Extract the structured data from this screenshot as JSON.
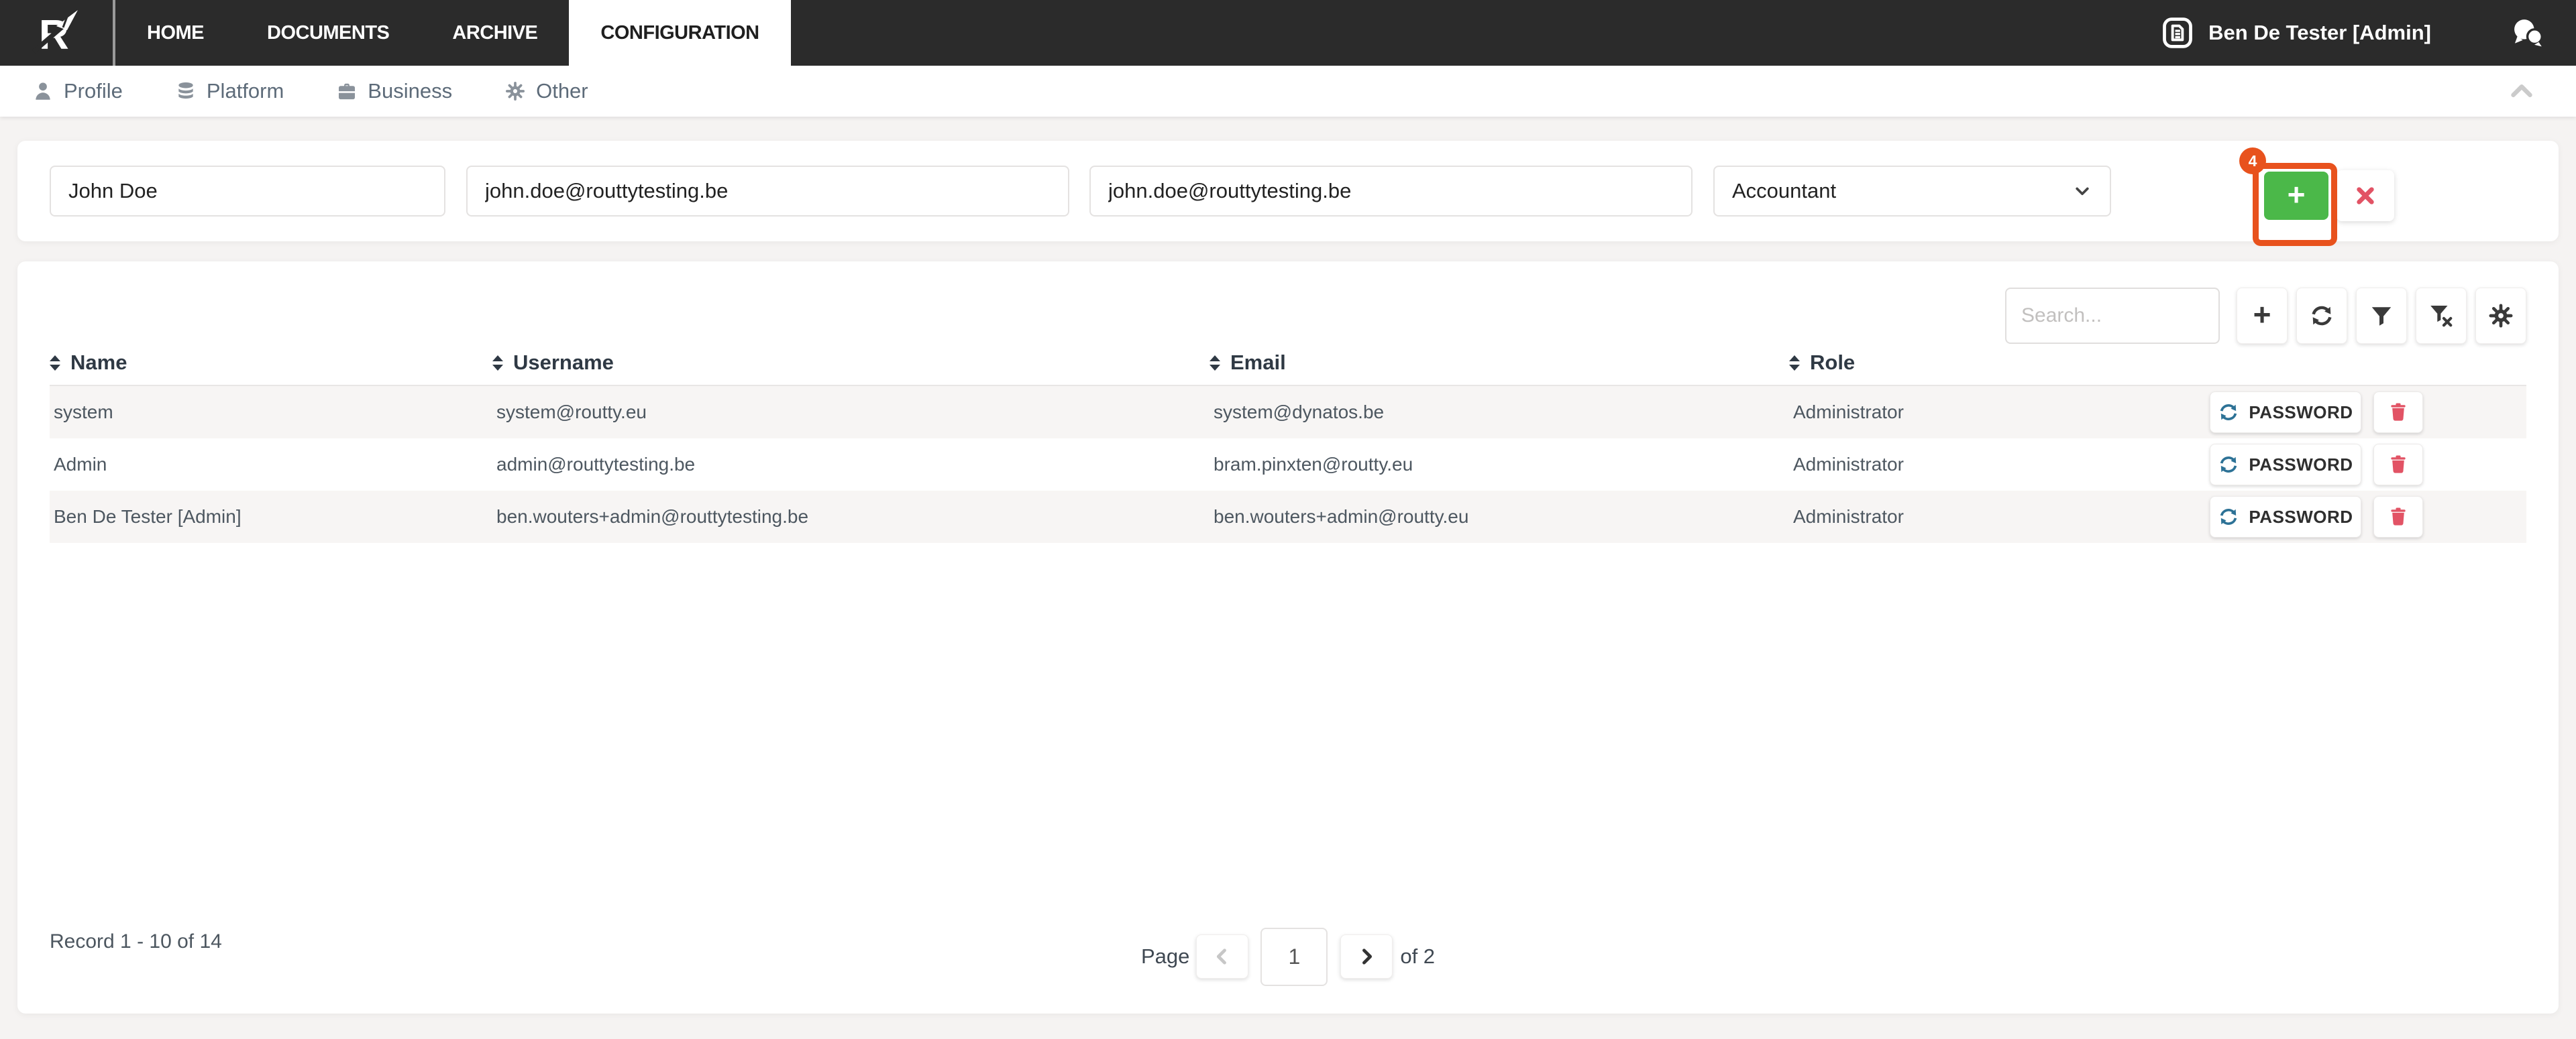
{
  "nav": {
    "items": [
      {
        "label": "HOME",
        "active": false
      },
      {
        "label": "DOCUMENTS",
        "active": false
      },
      {
        "label": "ARCHIVE",
        "active": false
      },
      {
        "label": "CONFIGURATION",
        "active": true
      }
    ],
    "user_label": "Ben De Tester [Admin]"
  },
  "subnav": {
    "items": [
      {
        "label": "Profile",
        "icon": "person-icon"
      },
      {
        "label": "Platform",
        "icon": "database-icon"
      },
      {
        "label": "Business",
        "icon": "briefcase-icon"
      },
      {
        "label": "Other",
        "icon": "gear-icon"
      }
    ]
  },
  "form": {
    "name_value": "John Doe",
    "username_value": "john.doe@routtytesting.be",
    "email_value": "john.doe@routtytesting.be",
    "role_value": "Accountant",
    "annotation_badge": "4"
  },
  "toolbar": {
    "search_placeholder": "Search..."
  },
  "table": {
    "columns": [
      "Name",
      "Username",
      "Email",
      "Role"
    ],
    "password_label": "PASSWORD",
    "rows": [
      {
        "name": "system",
        "username": "system@routty.eu",
        "email": "system@dynatos.be",
        "role": "Administrator"
      },
      {
        "name": "Admin",
        "username": "admin@routtytesting.be",
        "email": "bram.pinxten@routty.eu",
        "role": "Administrator"
      },
      {
        "name": "Ben De Tester [Admin]",
        "username": "ben.wouters+admin@routtytesting.be",
        "email": "ben.wouters+admin@routty.eu",
        "role": "Administrator"
      }
    ]
  },
  "footer": {
    "record_text": "Record 1 - 10 of 14",
    "page_label": "Page",
    "page_value": "1",
    "of_text": "of 2"
  },
  "colors": {
    "nav_bg": "#2b2b2b",
    "accent_green": "#4bb849",
    "annotation_orange": "#e8521d",
    "danger_red": "#e25365",
    "refresh_blue": "#2d7296",
    "stripe": "#f7f5f4"
  }
}
